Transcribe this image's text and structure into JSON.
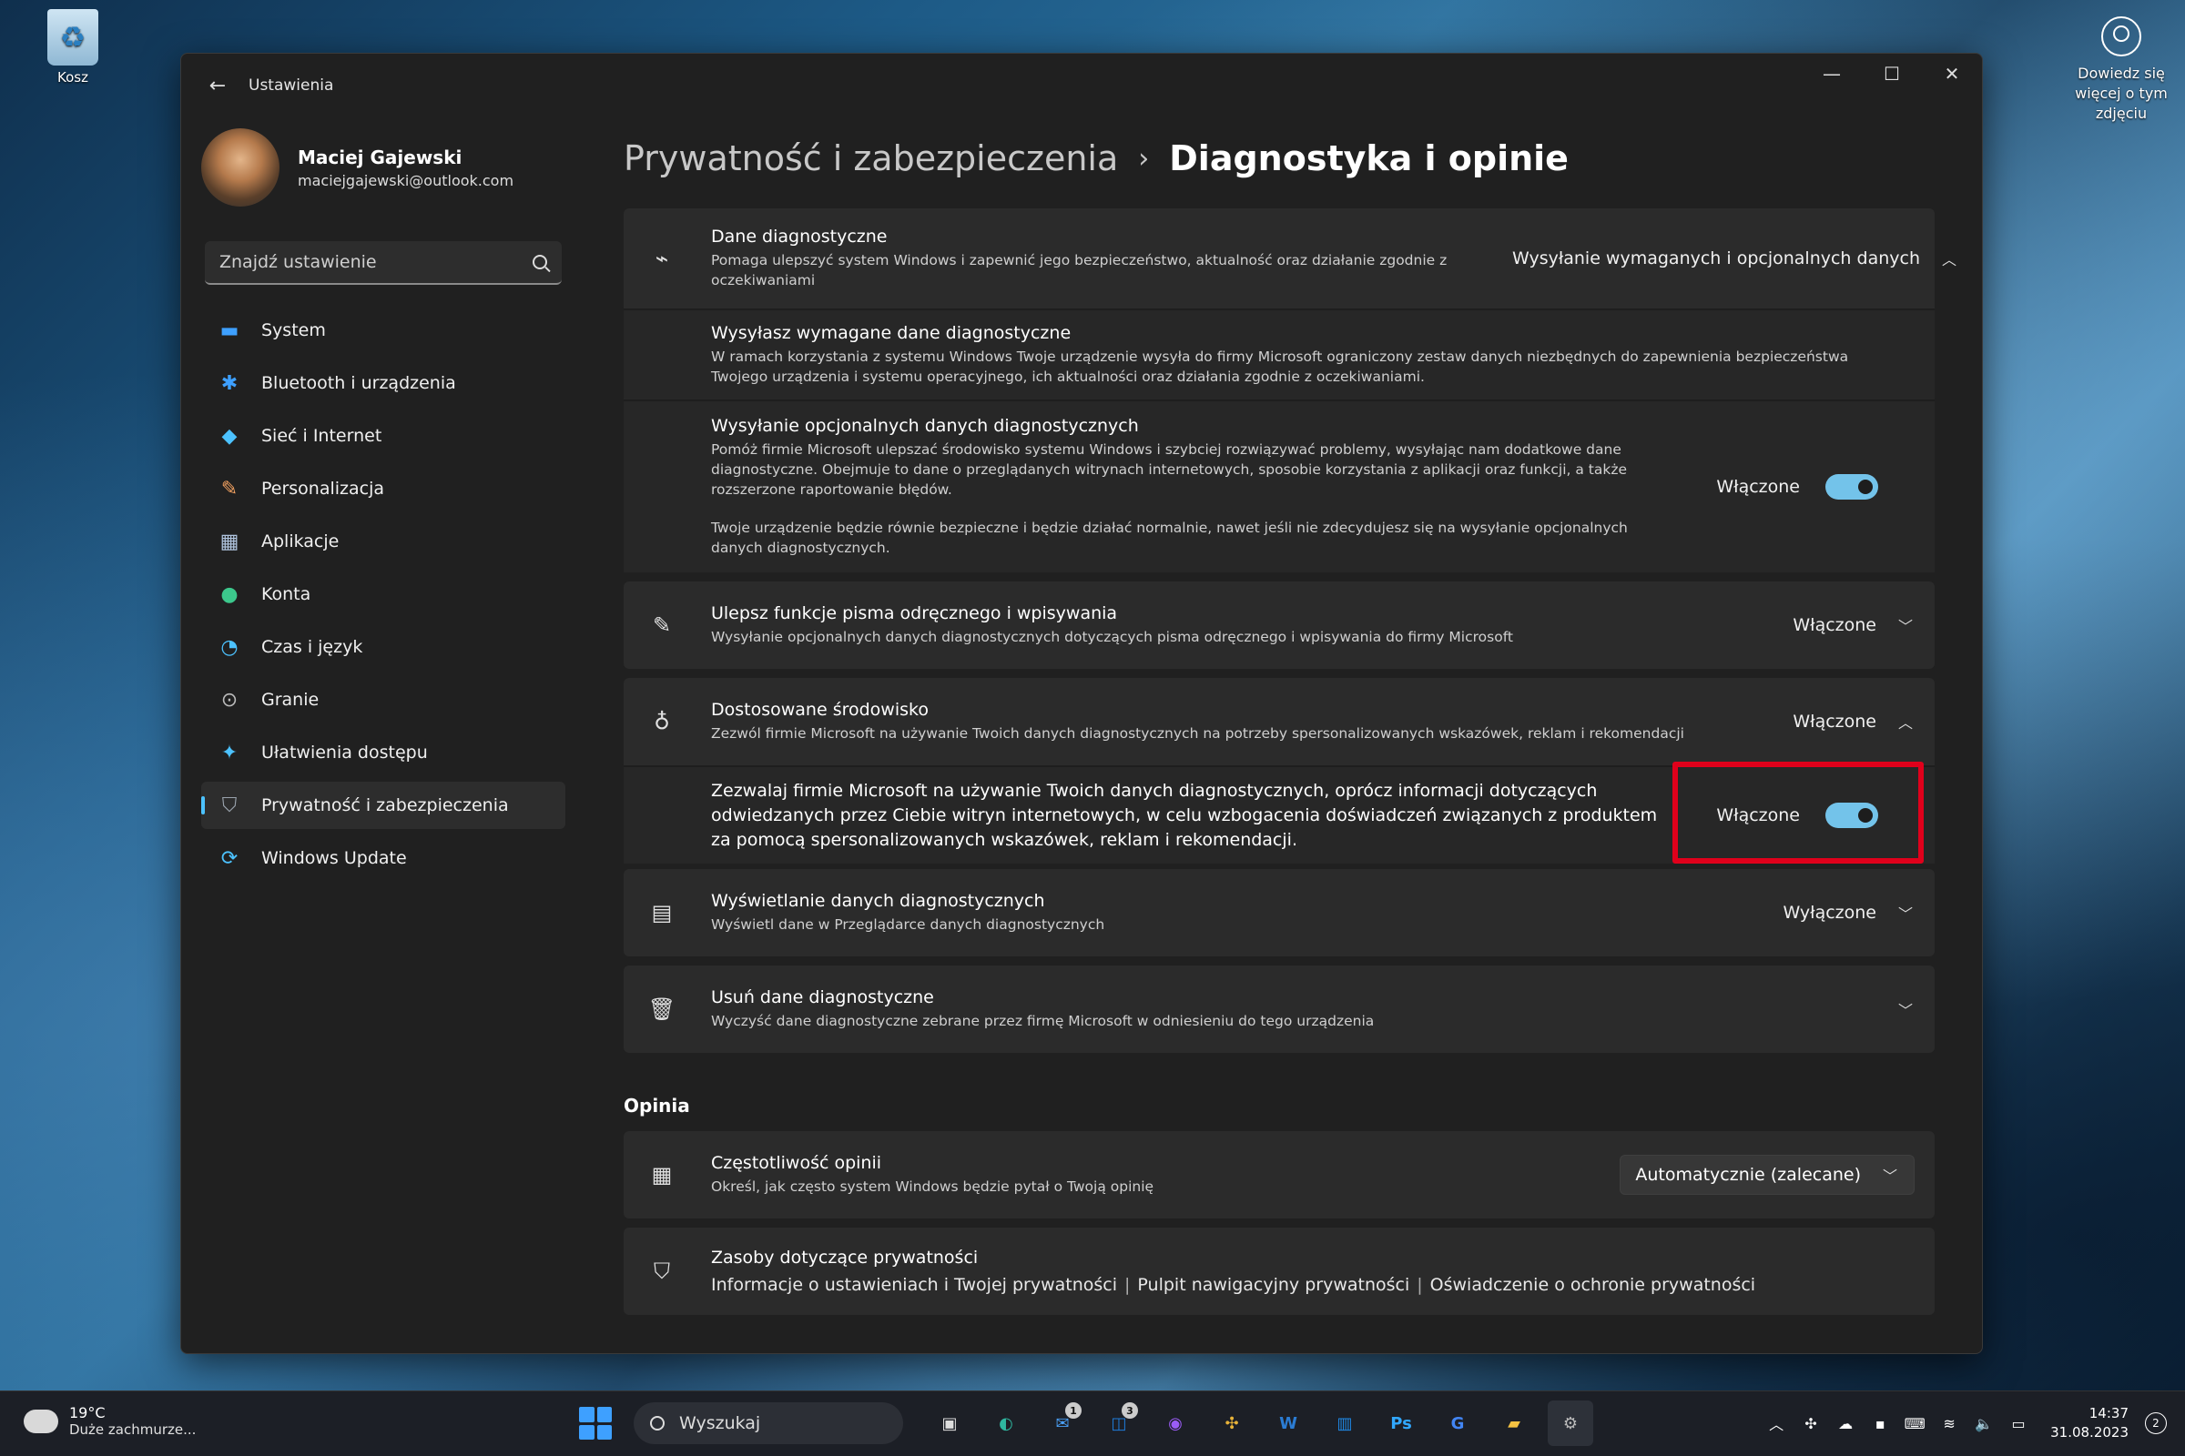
{
  "desktop": {
    "recycle_label": "Kosz",
    "learn_more": "Dowiedz się więcej o tym zdjęciu"
  },
  "window": {
    "title": "Ustawienia",
    "controls": {
      "minimize": "—",
      "maximize": "☐",
      "close": "✕"
    }
  },
  "profile": {
    "name": "Maciej Gajewski",
    "email": "maciejgajewski@outlook.com"
  },
  "search": {
    "placeholder": "Znajdź ustawienie"
  },
  "nav": [
    {
      "label": "System",
      "icon": "monitor-icon",
      "glyph": "▬",
      "color": "#3ea0ff"
    },
    {
      "label": "Bluetooth i urządzenia",
      "icon": "bluetooth-icon",
      "glyph": "✱",
      "color": "#3ea0ff"
    },
    {
      "label": "Sieć i Internet",
      "icon": "wifi-icon",
      "glyph": "◆",
      "color": "#4cc2ff"
    },
    {
      "label": "Personalizacja",
      "icon": "brush-icon",
      "glyph": "✎",
      "color": "#f0a060"
    },
    {
      "label": "Aplikacje",
      "icon": "apps-icon",
      "glyph": "▦",
      "color": "#b0c4de"
    },
    {
      "label": "Konta",
      "icon": "account-icon",
      "glyph": "●",
      "color": "#3cc88c"
    },
    {
      "label": "Czas i język",
      "icon": "clock-globe-icon",
      "glyph": "◔",
      "color": "#4cc2ff"
    },
    {
      "label": "Granie",
      "icon": "gamepad-icon",
      "glyph": "⊙",
      "color": "#bbbbbb"
    },
    {
      "label": "Ułatwienia dostępu",
      "icon": "accessibility-icon",
      "glyph": "✦",
      "color": "#4cc2ff"
    },
    {
      "label": "Prywatność i zabezpieczenia",
      "icon": "shield-icon",
      "glyph": "⛉",
      "color": "#9aa3ad",
      "active": true
    },
    {
      "label": "Windows Update",
      "icon": "update-icon",
      "glyph": "⟳",
      "color": "#4cc2ff"
    }
  ],
  "breadcrumb": {
    "parent": "Prywatność i zabezpieczenia",
    "separator": "›",
    "current": "Diagnostyka i opinie"
  },
  "diag": {
    "title": "Dane diagnostyczne",
    "desc": "Pomaga ulepszyć system Windows i zapewnić jego bezpieczeństwo, aktualność oraz działanie zgodnie z oczekiwaniami",
    "value": "Wysyłanie wymaganych i opcjonalnych danych",
    "chevron": "︿"
  },
  "required": {
    "title": "Wysyłasz wymagane dane diagnostyczne",
    "desc": "W ramach korzystania z systemu Windows Twoje urządzenie wysyła do firmy Microsoft ograniczony zestaw danych niezbędnych do zapewnienia bezpieczeństwa Twojego urządzenia i systemu operacyjnego, ich aktualności oraz działania zgodnie z oczekiwaniami."
  },
  "optional": {
    "title": "Wysyłanie opcjonalnych danych diagnostycznych",
    "desc": "Pomóż firmie Microsoft ulepszać środowisko systemu Windows i szybciej rozwiązywać problemy, wysyłając nam dodatkowe dane diagnostyczne. Obejmuje to dane o przeglądanych witrynach internetowych, sposobie korzystania z aplikacji oraz funkcji, a także rozszerzone raportowanie błędów.",
    "note": "Twoje urządzenie będzie równie bezpieczne i będzie działać normalnie, nawet jeśli nie zdecydujesz się na wysyłanie opcjonalnych danych diagnostycznych.",
    "state": "Włączone",
    "on": true
  },
  "inking": {
    "title": "Ulepsz funkcje pisma odręcznego i wpisywania",
    "desc": "Wysyłanie opcjonalnych danych diagnostycznych dotyczących pisma odręcznego i wpisywania do firmy Microsoft",
    "value": "Włączone",
    "chevron": "﹀"
  },
  "tailored": {
    "title": "Dostosowane środowisko",
    "desc": "Zezwól firmie Microsoft na używanie Twoich danych diagnostycznych na potrzeby spersonalizowanych wskazówek, reklam i rekomendacji",
    "value": "Włączone",
    "chevron": "︿",
    "sub_text": "Zezwalaj firmie Microsoft na używanie Twoich danych diagnostycznych, oprócz informacji dotyczących odwiedzanych przez Ciebie witryn internetowych, w celu wzbogacenia doświadczeń związanych z produktem za pomocą spersonalizowanych wskazówek, reklam i rekomendacji.",
    "sub_state": "Włączone",
    "sub_on": true
  },
  "viewer": {
    "title": "Wyświetlanie danych diagnostycznych",
    "desc": "Wyświetl dane w Przeglądarce danych diagnostycznych",
    "value": "Wyłączone",
    "chevron": "﹀"
  },
  "delete": {
    "title": "Usuń dane diagnostyczne",
    "desc": "Wyczyść dane diagnostyczne zebrane przez firmę Microsoft w odniesieniu do tego urządzenia",
    "chevron": "﹀"
  },
  "feedback_section": "Opinia",
  "frequency": {
    "title": "Częstotliwość opinii",
    "desc": "Określ, jak często system Windows będzie pytał o Twoją opinię",
    "value": "Automatycznie (zalecane)",
    "chevron": "﹀"
  },
  "resources": {
    "title": "Zasoby dotyczące prywatności",
    "links": [
      "Informacje o ustawieniach i Twojej prywatności",
      "Pulpit nawigacyjny prywatności",
      "Oświadczenie o ochronie prywatności"
    ],
    "separator": "|"
  },
  "taskbar": {
    "temp": "19°C",
    "weather": "Duże zachmurze...",
    "search": "Wyszukaj",
    "time": "14:37",
    "date": "31.08.2023",
    "notifications": "2",
    "apps": [
      {
        "name": "task-view",
        "glyph": "▣",
        "color": "#ddd"
      },
      {
        "name": "edge",
        "glyph": "◐",
        "color": "#2fb6a0"
      },
      {
        "name": "mail",
        "glyph": "✉",
        "color": "#4a9ff5",
        "badge": "1"
      },
      {
        "name": "outlook",
        "glyph": "◫",
        "color": "#1f7bd8",
        "badge": "3"
      },
      {
        "name": "messenger",
        "glyph": "◉",
        "color": "#9b5cf6"
      },
      {
        "name": "slack",
        "glyph": "✣",
        "color": "#e8b339"
      },
      {
        "name": "word",
        "glyph": "W",
        "color": "#2b7cd3"
      },
      {
        "name": "trello",
        "glyph": "▥",
        "color": "#1e88e5"
      },
      {
        "name": "photoshop",
        "glyph": "Ps",
        "color": "#31a8ff"
      },
      {
        "name": "translate",
        "glyph": "G",
        "color": "#4285f4"
      },
      {
        "name": "explorer",
        "glyph": "▰",
        "color": "#f5c242"
      },
      {
        "name": "settings",
        "glyph": "⚙",
        "color": "#bbb",
        "active": true
      }
    ],
    "tray": [
      {
        "name": "tray-chevron",
        "glyph": "︿"
      },
      {
        "name": "tray-slack",
        "glyph": "✣"
      },
      {
        "name": "tray-onedrive",
        "glyph": "☁"
      },
      {
        "name": "tray-defender",
        "glyph": "▪"
      },
      {
        "name": "tray-keyboard",
        "glyph": "⌨"
      },
      {
        "name": "tray-wifi",
        "glyph": "≋"
      },
      {
        "name": "tray-volume",
        "glyph": "🔈"
      },
      {
        "name": "tray-battery",
        "glyph": "▭"
      }
    ]
  }
}
